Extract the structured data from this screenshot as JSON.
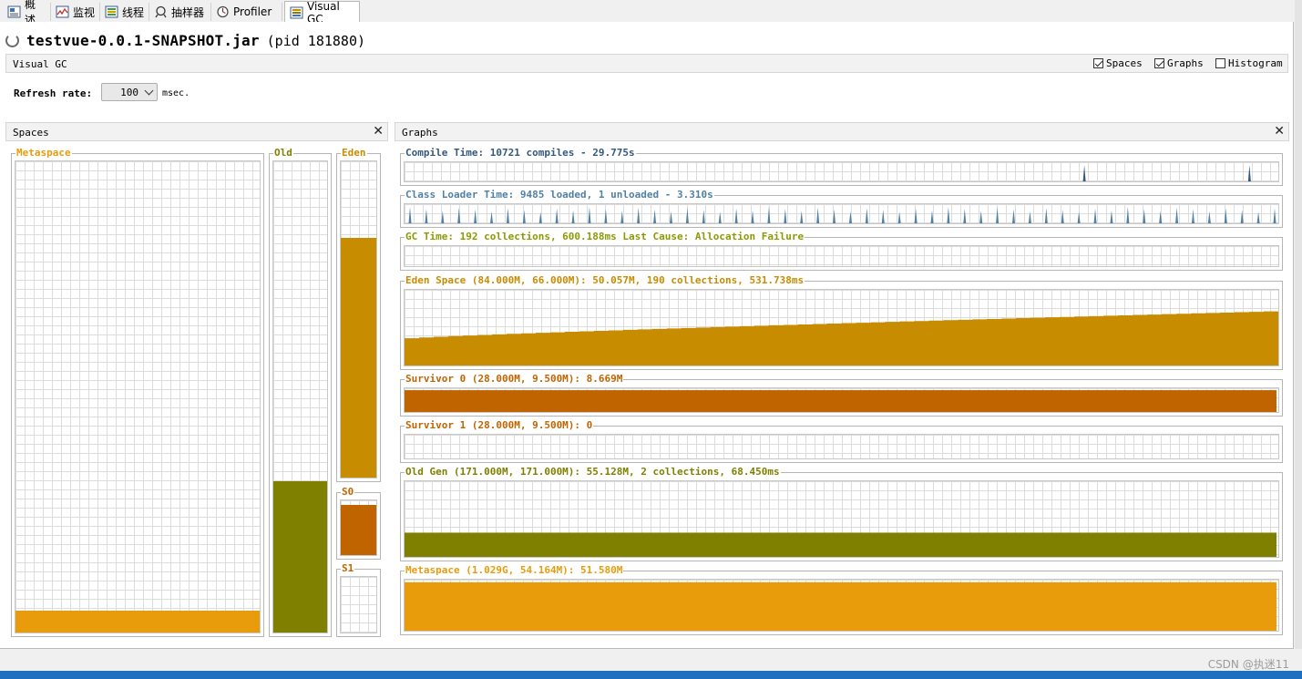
{
  "tabs": [
    {
      "label": "概述",
      "icon": "overview-icon",
      "active": false
    },
    {
      "label": "监视",
      "icon": "monitor-icon",
      "active": false
    },
    {
      "label": "线程",
      "icon": "threads-icon",
      "active": false
    },
    {
      "label": "抽样器",
      "icon": "sampler-icon",
      "active": false
    },
    {
      "label": "Profiler",
      "icon": "profiler-icon",
      "active": false
    },
    {
      "label": "Visual GC",
      "icon": "visualgc-icon",
      "active": true
    }
  ],
  "header": {
    "app": "testvue-0.0.1-SNAPSHOT.jar",
    "pid": "(pid 181880)"
  },
  "visualgc": {
    "label": "Visual GC",
    "options": [
      {
        "label": "Spaces",
        "checked": true
      },
      {
        "label": "Graphs",
        "checked": true
      },
      {
        "label": "Histogram",
        "checked": false
      }
    ],
    "refresh_label": "Refresh rate:",
    "refresh_value": "100",
    "refresh_unit": "msec."
  },
  "spaces": {
    "title": "Spaces",
    "close": "✕",
    "metaspace": {
      "label": "Metaspace",
      "fill": 0.047,
      "color": "#E89C0C"
    },
    "old": {
      "label": "Old",
      "fill": 0.322,
      "color": "#808000"
    },
    "eden": {
      "label": "Eden",
      "fill": 0.758,
      "color": "#C88C00"
    },
    "s0": {
      "label": "S0",
      "fill": 0.91,
      "color": "#C06400"
    },
    "s1": {
      "label": "S1",
      "fill": 0.0,
      "color": "#C06400"
    }
  },
  "graphs": {
    "title": "Graphs",
    "close": "✕",
    "items": [
      {
        "key": "compile",
        "label": "Compile Time: 10721 compiles - 29.775s",
        "color": "#34597E"
      },
      {
        "key": "classloader",
        "label": "Class Loader Time: 9485 loaded, 1 unloaded - 3.310s",
        "color": "#4F81A6"
      },
      {
        "key": "gc",
        "label": "GC Time: 192 collections, 600.188ms Last Cause: Allocation Failure",
        "color": "#8C9A00"
      },
      {
        "key": "eden",
        "label": "Eden Space (84.000M, 66.000M): 50.057M, 190 collections, 531.738ms",
        "color": "#C88C00"
      },
      {
        "key": "s0",
        "label": "Survivor 0 (28.000M, 9.500M): 8.669M",
        "color": "#C06400"
      },
      {
        "key": "s1",
        "label": "Survivor 1 (28.000M, 9.500M): 0",
        "color": "#C06400"
      },
      {
        "key": "old",
        "label": "Old Gen (171.000M, 171.000M): 55.128M, 2 collections, 68.450ms",
        "color": "#808000"
      },
      {
        "key": "metaspace",
        "label": "Metaspace (1.029G, 54.164M): 51.580M",
        "color": "#E89C0C"
      }
    ]
  },
  "watermark": "CSDN @执迷11"
}
